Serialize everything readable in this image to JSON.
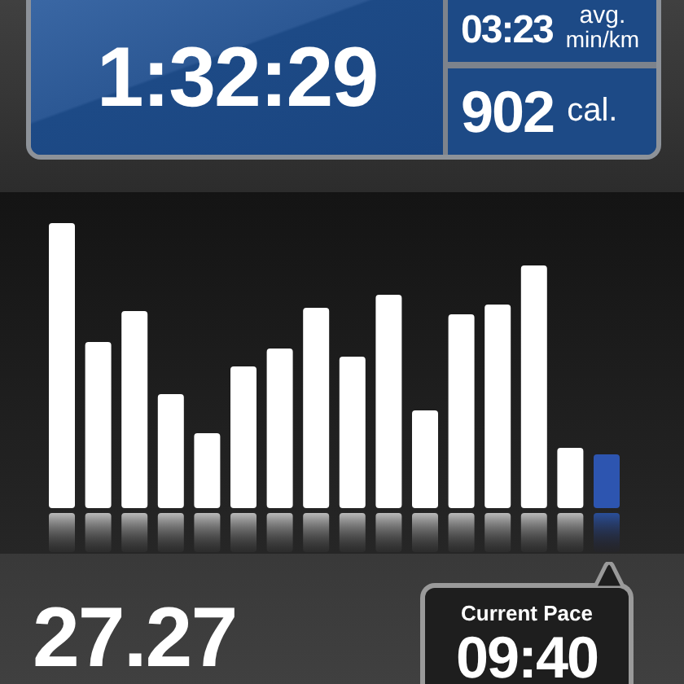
{
  "workout": {
    "duration": "1:32:29",
    "avg_pace": {
      "value": "03:23",
      "label": "avg.",
      "unit": "min/km"
    },
    "calories": {
      "value": "902",
      "unit": "cal."
    }
  },
  "distance": "27.27",
  "current_pace": {
    "label": "Current Pace",
    "value": "09:40"
  }
}
